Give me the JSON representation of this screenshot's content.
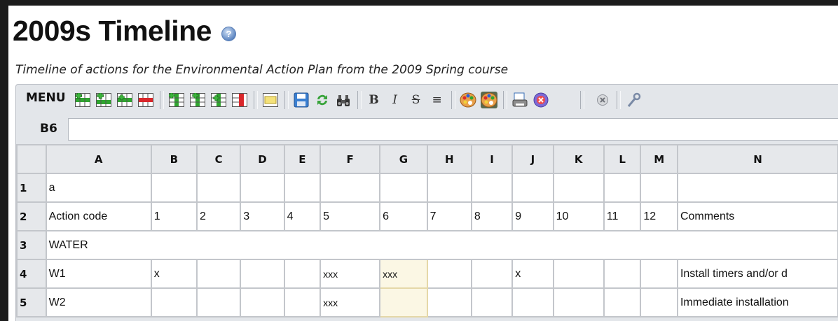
{
  "page": {
    "title": "2009s Timeline",
    "subtitle": "Timeline of actions for the Environmental Action Plan from the 2009 Spring course"
  },
  "toolbar": {
    "menu_label": "MENU",
    "buttons": [
      {
        "name": "insert-row-before-icon"
      },
      {
        "name": "insert-row-after-icon"
      },
      {
        "name": "insert-row-icon"
      },
      {
        "name": "delete-row-icon"
      },
      {
        "name": "insert-column-before-icon"
      },
      {
        "name": "insert-column-after-icon"
      },
      {
        "name": "insert-column-icon"
      },
      {
        "name": "delete-column-icon"
      },
      {
        "name": "merge-cells-icon"
      },
      {
        "name": "save-icon"
      },
      {
        "name": "refresh-icon"
      },
      {
        "name": "find-icon"
      },
      {
        "name": "bold-icon",
        "text": "B"
      },
      {
        "name": "italic-icon",
        "text": "I"
      },
      {
        "name": "strikethrough-icon",
        "text": "S"
      },
      {
        "name": "align-icon",
        "text": "≡"
      },
      {
        "name": "text-color-icon"
      },
      {
        "name": "background-color-icon"
      },
      {
        "name": "print-icon"
      },
      {
        "name": "cancel-icon"
      },
      {
        "name": "close-icon"
      },
      {
        "name": "settings-icon"
      }
    ]
  },
  "cell_ref": "B6",
  "grid": {
    "columns": [
      "A",
      "B",
      "C",
      "D",
      "E",
      "F",
      "G",
      "H",
      "I",
      "J",
      "K",
      "L",
      "M",
      "N"
    ],
    "rows": [
      {
        "num": "1",
        "cells": [
          "a",
          "",
          "",
          "",
          "",
          "",
          "",
          "",
          "",
          "",
          "",
          "",
          "",
          ""
        ]
      },
      {
        "num": "2",
        "cells": [
          "Action code",
          "1",
          "2",
          "3",
          "4",
          "5",
          "6",
          "7",
          "8",
          "9",
          "10",
          "11",
          "12",
          "Comments"
        ]
      },
      {
        "num": "3",
        "merged": "WATER"
      },
      {
        "num": "4",
        "cells": [
          "W1",
          "x",
          "",
          "",
          "",
          "xxx",
          "xxx",
          "",
          "",
          "x",
          "",
          "",
          "",
          "Install timers and/or d"
        ]
      },
      {
        "num": "5",
        "cells": [
          "W2",
          "",
          "",
          "",
          "",
          "xxx",
          "",
          "",
          "",
          "",
          "",
          "",
          "",
          "Immediate installation"
        ]
      }
    ]
  },
  "colors": {
    "selected_cell": "#fbf7e4",
    "header_bg": "#e6e8eb",
    "toolbar_bg": "#e3e6ea"
  }
}
